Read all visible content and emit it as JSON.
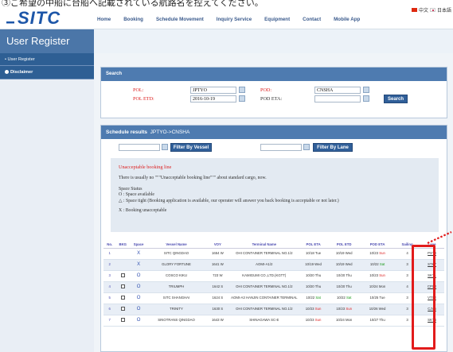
{
  "top_note": "③ご希望の中船に台船へ記載されている航路名を控えてください。",
  "logo_text": "SITC",
  "nav": [
    "Home",
    "Booking",
    "Schedule Movement",
    "Inquiry Service",
    "Equipment",
    "Contact",
    "Mobile App"
  ],
  "languages": [
    "中文",
    "日本語"
  ],
  "page_title": "User Register",
  "sidebar": [
    {
      "label": "• User Register"
    },
    {
      "label": "Disclaimer"
    }
  ],
  "search": {
    "title": "Search",
    "pol_label": "POL:",
    "pol_value": "JPTYO",
    "pod_label": "POD:",
    "pod_value": "CNSHA",
    "pol_etd_label": "POL ETD:",
    "pol_etd_value": "2016-10-19",
    "pod_eta_label": "POD ETA:",
    "pod_eta_value": "",
    "search_button": "Search"
  },
  "results": {
    "title": "Schedule results",
    "route": "JPTYO->CNSHA",
    "filter_vessel_button": "Filter By Vessel",
    "filter_lane_button": "Filter By Lane",
    "warning": "Unacceptable booking line",
    "notice": "There is usually no \"\"\"Unacceptable booking line\"\"\" about standard cargo, now.",
    "space_status": "Space Status",
    "space_available": "O : Space available",
    "space_tight": "△ : Space tight (Booking application is available, our operater will answer you back booking is acceptable or not later.)",
    "space_unacceptable": "X : Booking unacceptable"
  },
  "table": {
    "headers": [
      "No.",
      "BKG",
      "Space",
      "Vessel Name",
      "VOY",
      "Terminal Name",
      "POL ETA",
      "POL ETD",
      "POD ETA",
      "Sailing",
      "Lane"
    ],
    "rows": [
      {
        "no": "1",
        "bkg": false,
        "space": "X",
        "vessel": "SITC QINGDAO",
        "voy": "1654 W",
        "terminal": "OHI CONTAINER TERMINAL NO.1/2",
        "pol_eta": "10/18 Tue",
        "pol_eta_day": "",
        "pol_etd": "10/19 Wed",
        "pol_etd_day": "",
        "pod_eta": "10/23",
        "pod_eta_day": "Sun",
        "sailing": "4",
        "lane": "PST3"
      },
      {
        "no": "2",
        "bkg": false,
        "space": "X",
        "vessel": "GLORY FORTUNE",
        "voy": "1641 W",
        "terminal": "AOMI-A1/2",
        "pol_eta": "10/19 Wed",
        "pol_eta_day": "",
        "pol_etd": "10/19 Wed",
        "pol_etd_day": "",
        "pod_eta": "10/22",
        "pod_eta_day": "Sat",
        "sailing": "3",
        "lane": "STK7"
      },
      {
        "no": "3",
        "bkg": true,
        "space": "O",
        "vessel": "COSCO KIKU",
        "voy": "723 W",
        "terminal": "KAMIGUMI CO.,LTD.(KGTT)",
        "pol_eta": "10/20 Thu",
        "pol_eta_day": "",
        "pol_etd": "10/20 Thu",
        "pol_etd_day": "",
        "pod_eta": "10/23",
        "pod_eta_day": "Sun",
        "sailing": "3",
        "lane": "SKT1"
      },
      {
        "no": "4",
        "bkg": true,
        "space": "O",
        "vessel": "TRIUMPH",
        "voy": "1642 S",
        "terminal": "OHI CONTAINER TERMINAL NO.1/2",
        "pol_eta": "10/20 Thu",
        "pol_eta_day": "",
        "pol_etd": "10/20 Thu",
        "pol_etd_day": "",
        "pod_eta": "10/24 Mon",
        "pod_eta_day": "",
        "sailing": "4",
        "lane": "CPS2"
      },
      {
        "no": "5",
        "bkg": true,
        "space": "O",
        "vessel": "SITC SHANGHAI",
        "voy": "1624 S",
        "terminal": "AOMI-A3 HANJIN CONTAINER TERMINAL",
        "pol_eta": "10/22",
        "pol_eta_day": "Sat",
        "pol_etd": "10/22",
        "pol_etd_day": "Sat",
        "pod_eta": "10/25 Tue",
        "pod_eta_day": "",
        "sailing": "3",
        "lane": "VTX2"
      },
      {
        "no": "6",
        "bkg": true,
        "space": "O",
        "vessel": "TRINITY",
        "voy": "1630 S",
        "terminal": "OHI CONTAINER TERMINAL NO.1/2",
        "pol_eta": "10/23",
        "pol_eta_day": "Sun",
        "pol_etd": "10/23",
        "pol_etd_day": "Sun",
        "pod_eta": "10/26 Wed",
        "pod_eta_day": "",
        "sailing": "3",
        "lane": "CJV6"
      },
      {
        "no": "7",
        "bkg": true,
        "space": "O",
        "vessel": "SINOTRANS QINGDAO",
        "voy": "1643 W",
        "terminal": "SHINAGAWA SC-E",
        "pol_eta": "10/23",
        "pol_eta_day": "Sun",
        "pol_etd": "10/24 Mon",
        "pol_etd_day": "",
        "pod_eta": "10/27 Thu",
        "pod_eta_day": "",
        "sailing": "3",
        "lane": "SKT4"
      }
    ]
  },
  "colors": {
    "nav": "#3a5a8c",
    "panel_head": "#4e7bb0",
    "sidebar": "#2e5f94",
    "highlight": "#e21b1b",
    "logo": "#1d56a8"
  }
}
